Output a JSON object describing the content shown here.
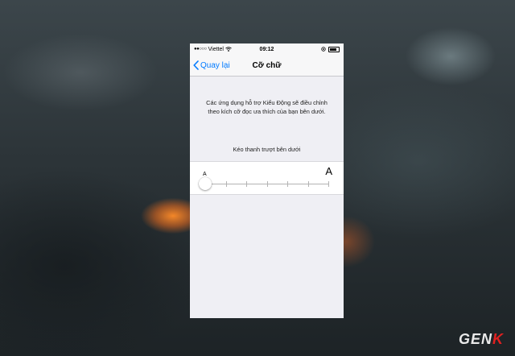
{
  "status_bar": {
    "signal": "●●○○○",
    "carrier": "Viettel",
    "time": "09:12"
  },
  "nav": {
    "back_label": "Quay lại",
    "title": "Cỡ chữ"
  },
  "content": {
    "description": "Các ứng dụng hỗ trợ Kiểu Động sẽ điều chỉnh theo kích cỡ đọc ưa thích của bạn bên dưới.",
    "hint": "Kéo thanh trượt bên dưới",
    "small_a": "A",
    "large_a": "A"
  },
  "slider": {
    "level": 0,
    "steps": 7
  },
  "watermark": {
    "text": "GEN",
    "accent": "K"
  }
}
